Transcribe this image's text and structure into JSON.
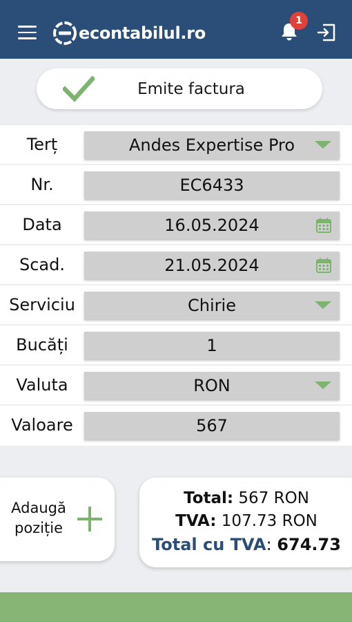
{
  "app": {
    "logo_text": "econtabilul.ro",
    "notification_count": "1",
    "colors": {
      "primary": "#2a4e77",
      "accent": "#7cb36e",
      "badge": "#e2403b"
    },
    "icons": [
      "menu-icon",
      "logo-icon",
      "bell-icon",
      "logout-icon",
      "check-icon",
      "dropdown-arrow-icon",
      "calendar-icon",
      "plus-icon"
    ]
  },
  "actions": {
    "emit_label": "Emite factura",
    "add_position_line1": "Adaugă",
    "add_position_line2": "poziție"
  },
  "form": {
    "tert": {
      "label": "Terț",
      "value": "Andes Expertise Pro"
    },
    "nr": {
      "label": "Nr.",
      "value": "EC6433"
    },
    "data": {
      "label": "Data",
      "value": "16.05.2024"
    },
    "scad": {
      "label": "Scad.",
      "value": "21.05.2024"
    },
    "serviciu": {
      "label": "Serviciu",
      "value": "Chirie"
    },
    "bucati": {
      "label": "Bucăți",
      "value": "1"
    },
    "valuta": {
      "label": "Valuta",
      "value": "RON"
    },
    "valoare": {
      "label": "Valoare",
      "value": "567"
    }
  },
  "totals": {
    "total_label": "Total:",
    "total_value": "567 RON",
    "tva_label": "TVA:",
    "tva_value": "107.73 RON",
    "total_tva_label": "Total cu TVA",
    "colon": ":",
    "total_tva_value": "674.73"
  }
}
